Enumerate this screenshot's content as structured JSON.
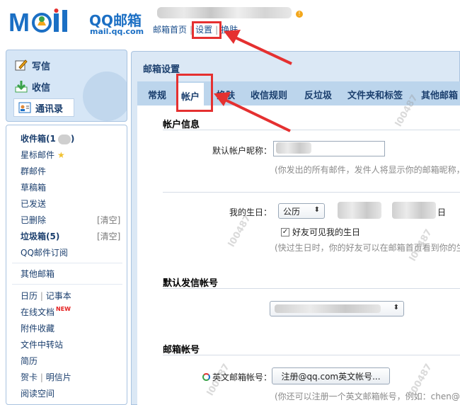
{
  "header": {
    "logo_text": "QQ邮箱",
    "logo_domain": "mail.qq.com",
    "nav": {
      "home": "邮箱首页",
      "settings": "设置",
      "skin": "换肤",
      "separator": "|"
    },
    "notify_badge": "!"
  },
  "sidebar": {
    "compose": "写信",
    "inbox": "收信",
    "contacts": "通讯录",
    "items": {
      "inbox_folder": "收件箱(1",
      "inbox_folder_end": ")",
      "starred": "星标邮件",
      "group": "群邮件",
      "drafts": "草稿箱",
      "sent": "已发送",
      "deleted": "已删除",
      "deleted_clear": "[清空]",
      "spam": "垃圾箱(5)",
      "spam_clear": "[清空]",
      "subscriptions": "QQ邮件订阅",
      "other_mail": "其他邮箱",
      "calendar": "日历",
      "notes": "记事本",
      "pipe": "|",
      "online_docs": "在线文档",
      "new_badge": "NEW",
      "attachments": "附件收藏",
      "file_transfer": "文件中转站",
      "resume": "简历",
      "cards": "贺卡",
      "postcards": "明信片",
      "reading": "阅读空间"
    }
  },
  "main": {
    "title": "邮箱设置",
    "tabs": [
      "常规",
      "帐户",
      "换肤",
      "收信规则",
      "反垃圾",
      "文件夹和标签",
      "其他邮箱"
    ],
    "active_tab": "帐户",
    "sections": {
      "account_info": {
        "title": "帐户信息",
        "nickname_label": "默认帐户昵称：",
        "nickname_hint": "(你发出的所有邮件，发件人将显示你的邮箱昵称，",
        "birthday_label": "我的生日：",
        "calendar_select": "公历",
        "day_suffix": "日",
        "birthday_visible": "好友可见我的生日",
        "birthday_visible_checked": true,
        "birthday_hint": "(快过生日时，你的好友可以在邮箱首页看到你的生"
      },
      "default_sender": {
        "title": "默认发信帐号"
      },
      "mail_account": {
        "title": "邮箱帐号",
        "english_label": "英文邮箱帐号：",
        "register_button": "注册@qq.com英文帐号...",
        "english_hint": "(你还可以注册一个英文邮箱帐号，例如：chen@q"
      }
    },
    "watermark": "l00487"
  },
  "colors": {
    "brand_blue": "#1b6fc4",
    "annotation_red": "#e53030",
    "panel_bg": "#dbe8f5",
    "tab_bar": "#bcd5ec"
  }
}
